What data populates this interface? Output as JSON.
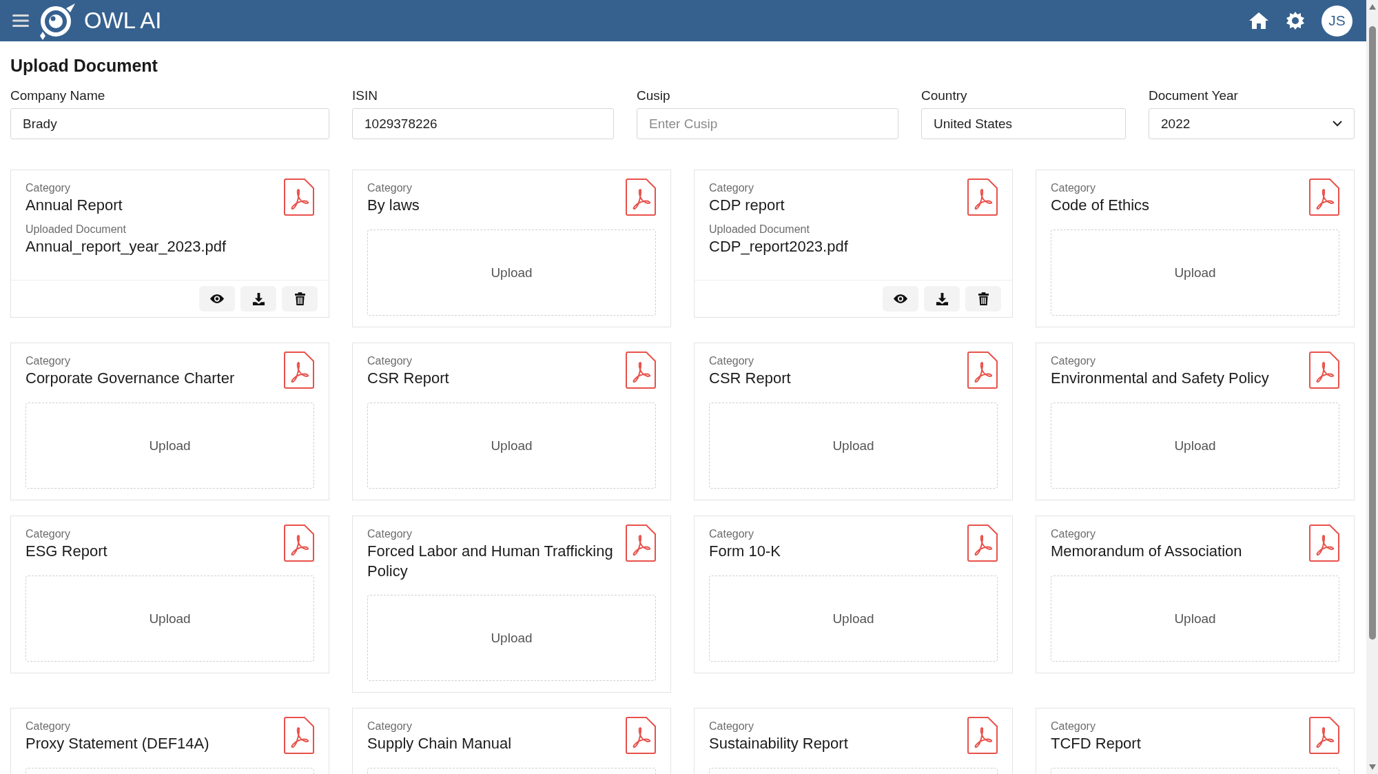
{
  "app": {
    "title": "OWL AI",
    "avatar_initials": "JS"
  },
  "page_title": "Upload Document",
  "fields": [
    {
      "kind": "text",
      "label": "Company Name",
      "value": "Brady"
    },
    {
      "kind": "text",
      "label": "ISIN",
      "value": "1029378226"
    },
    {
      "kind": "text",
      "label": "Cusip",
      "placeholder": "Enter Cusip"
    },
    {
      "kind": "text",
      "label": "Country",
      "value": "United States"
    },
    {
      "kind": "select",
      "label": "Document Year",
      "value": "2022"
    }
  ],
  "cards": [
    {
      "kind": "uploaded",
      "category_label": "Category",
      "category": "Annual Report",
      "document_label": "Uploaded Document",
      "document": "Annual_report_year_2023.pdf"
    },
    {
      "kind": "upload",
      "category_label": "Category",
      "category": "By laws",
      "upload_label": "Upload"
    },
    {
      "kind": "uploaded",
      "category_label": "Category",
      "category": "CDP report",
      "document_label": "Uploaded Document",
      "document": "CDP_report2023.pdf"
    },
    {
      "kind": "upload",
      "category_label": "Category",
      "category": "Code of Ethics",
      "upload_label": "Upload"
    },
    {
      "kind": "upload",
      "category_label": "Category",
      "category": "Corporate Governance Charter",
      "upload_label": "Upload"
    },
    {
      "kind": "upload",
      "category_label": "Category",
      "category": "CSR Report",
      "upload_label": "Upload"
    },
    {
      "kind": "upload",
      "category_label": "Category",
      "category": "CSR Report",
      "upload_label": "Upload"
    },
    {
      "kind": "upload",
      "category_label": "Category",
      "category": "Environmental and Safety Policy",
      "upload_label": "Upload"
    },
    {
      "kind": "upload",
      "category_label": "Category",
      "category": "ESG Report",
      "upload_label": "Upload"
    },
    {
      "kind": "upload",
      "category_label": "Category",
      "category": "Forced Labor and Human Trafficking Policy",
      "upload_label": "Upload"
    },
    {
      "kind": "upload",
      "category_label": "Category",
      "category": "Form 10-K",
      "upload_label": "Upload"
    },
    {
      "kind": "upload",
      "category_label": "Category",
      "category": "Memorandum of Association",
      "upload_label": "Upload"
    },
    {
      "kind": "upload",
      "category_label": "Category",
      "category": "Proxy Statement (DEF14A)"
    },
    {
      "kind": "upload",
      "category_label": "Category",
      "category": "Supply Chain Manual"
    },
    {
      "kind": "upload",
      "category_label": "Category",
      "category": "Sustainability Report"
    },
    {
      "kind": "upload",
      "category_label": "Category",
      "category": "TCFD Report"
    }
  ]
}
